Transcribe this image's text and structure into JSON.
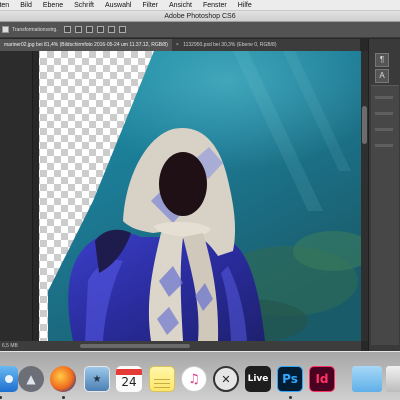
{
  "menubar": {
    "items": [
      "eiten",
      "Bild",
      "Ebene",
      "Schrift",
      "Auswahl",
      "Filter",
      "Ansicht",
      "Fenster",
      "Hilfe"
    ]
  },
  "window": {
    "title": "Adobe Photoshop CS6"
  },
  "options_bar": {
    "transform_label": "Transformationsstrg."
  },
  "tabs": [
    {
      "label": "mariner02.jpg bei 81,4% (Bildschirmfoto 2016-05-24 um 11.37.12, RGB/8)",
      "active": true
    },
    {
      "label": "1132950.psd bei 30,3% (Ebene 0, RGB/8)",
      "active": false,
      "close": "×"
    }
  ],
  "status_bar": {
    "doc_size": "6,5 MB"
  },
  "panels": {
    "icons": [
      "paragraph-icon",
      "character-icon"
    ]
  },
  "dock": {
    "items": [
      {
        "name": "finder-icon",
        "label": ""
      },
      {
        "name": "launchpad-icon",
        "label": ""
      },
      {
        "name": "firefox-icon",
        "label": ""
      },
      {
        "name": "preview-icon",
        "label": ""
      },
      {
        "name": "calendar-icon",
        "label": "24",
        "month": ""
      },
      {
        "name": "notes-icon",
        "label": ""
      },
      {
        "name": "itunes-icon",
        "label": ""
      },
      {
        "name": "migration-icon",
        "label": ""
      },
      {
        "name": "steam-icon",
        "label": ""
      },
      {
        "name": "ableton-live-icon",
        "label": "Live"
      },
      {
        "name": "photoshop-icon",
        "label": "Ps"
      },
      {
        "name": "indesign-icon",
        "label": "Id"
      },
      {
        "name": "folder-icon",
        "label": ""
      },
      {
        "name": "trash-icon",
        "label": ""
      }
    ]
  },
  "colors": {
    "photoshop": "#001d34",
    "photoshop_text": "#31a8ff",
    "indesign": "#49021f",
    "indesign_text": "#ff3366",
    "water": "#1f7f96",
    "robe": "#2b2fa8"
  }
}
